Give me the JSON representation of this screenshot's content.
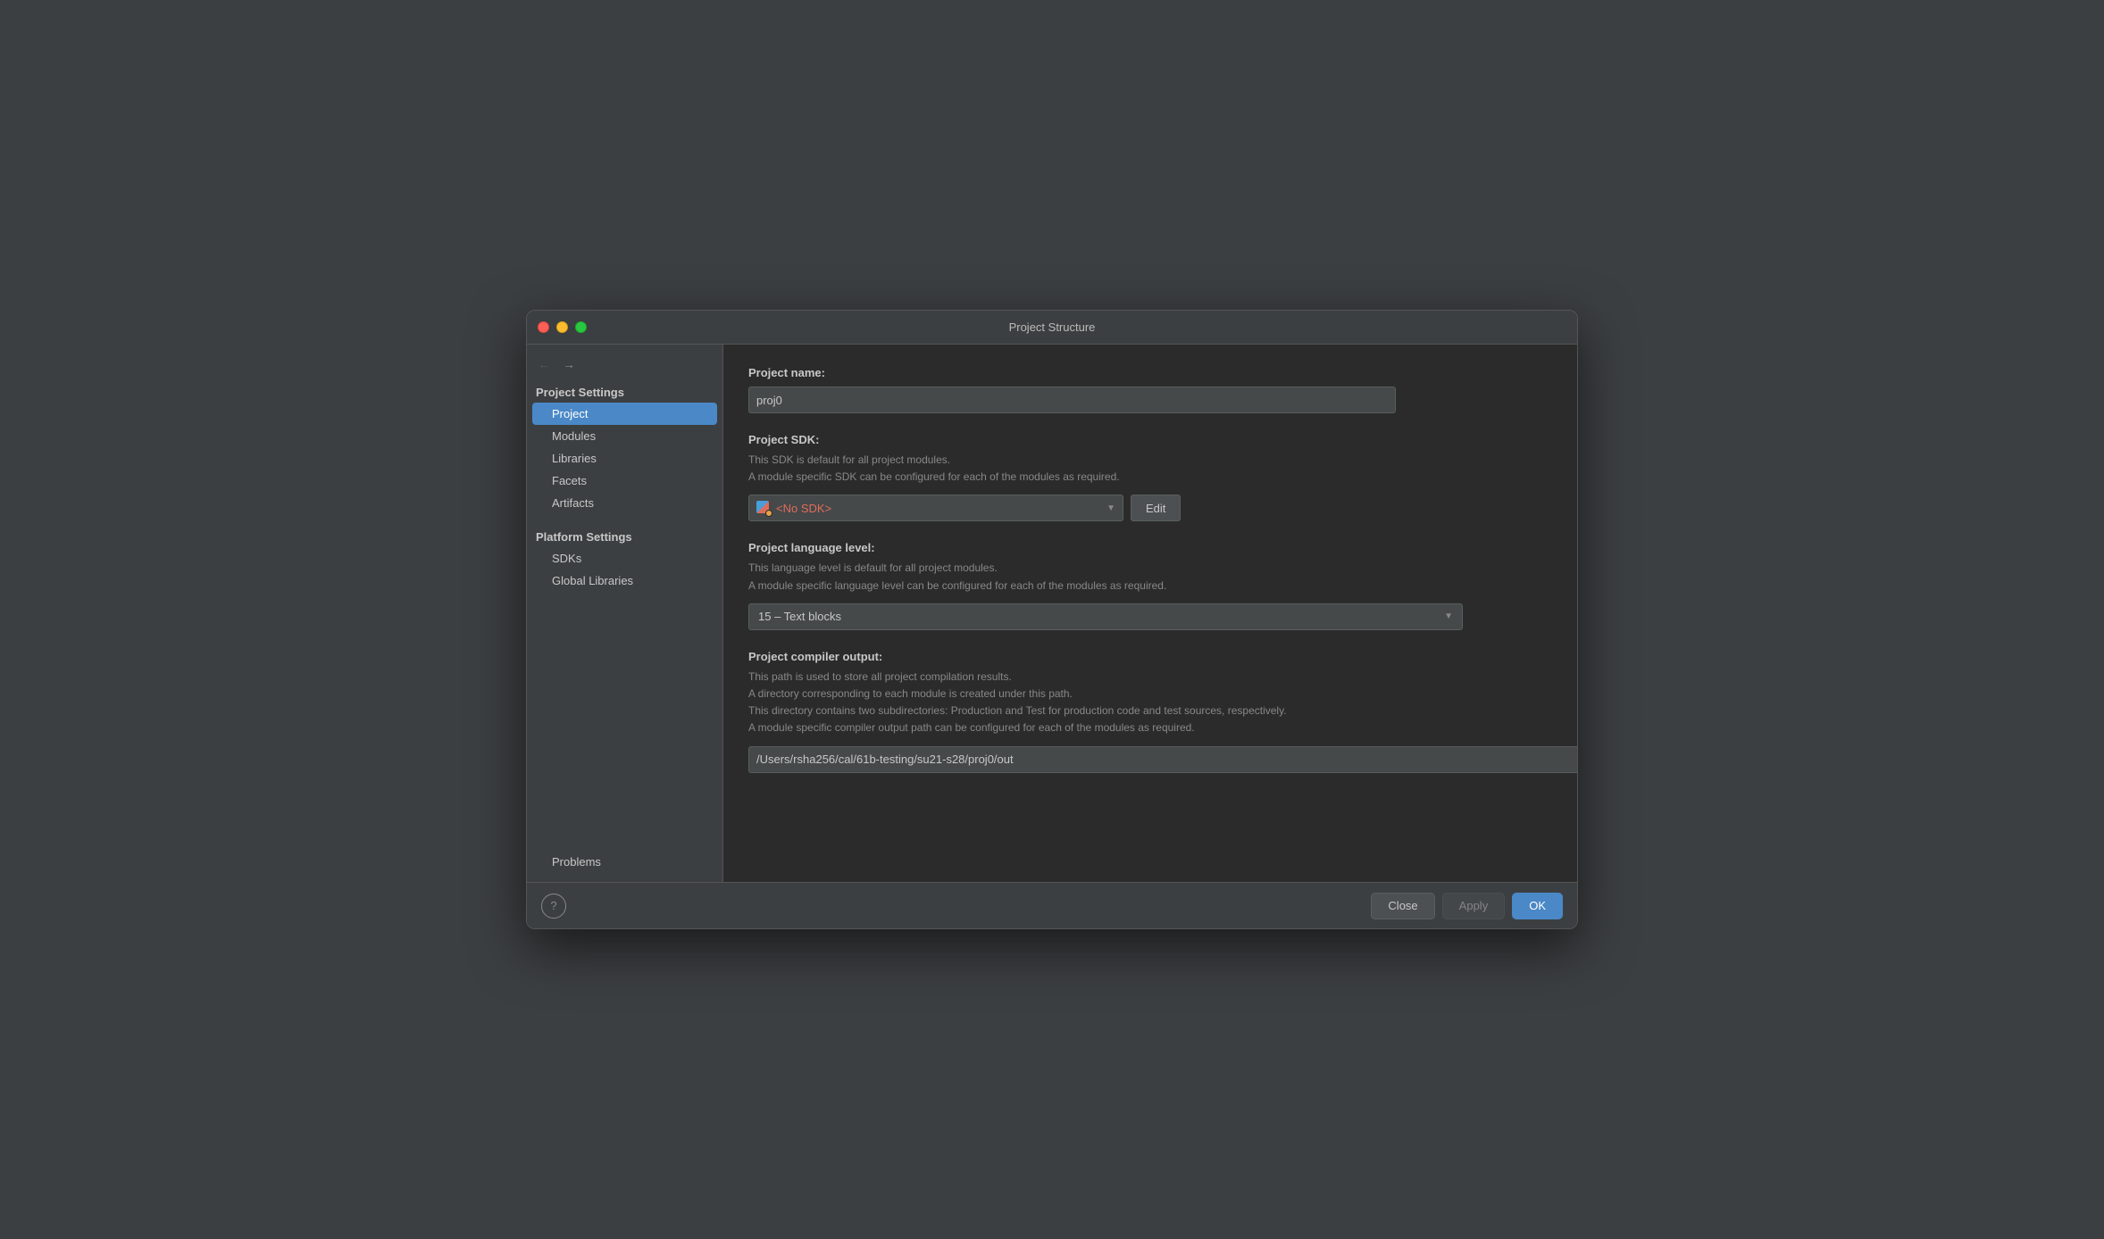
{
  "titlebar": {
    "title": "Project Structure"
  },
  "sidebar": {
    "nav": {
      "back_label": "←",
      "forward_label": "→"
    },
    "project_settings_header": "Project Settings",
    "items": [
      {
        "id": "project",
        "label": "Project",
        "active": true
      },
      {
        "id": "modules",
        "label": "Modules",
        "active": false
      },
      {
        "id": "libraries",
        "label": "Libraries",
        "active": false
      },
      {
        "id": "facets",
        "label": "Facets",
        "active": false
      },
      {
        "id": "artifacts",
        "label": "Artifacts",
        "active": false
      }
    ],
    "platform_settings_header": "Platform Settings",
    "platform_items": [
      {
        "id": "sdks",
        "label": "SDKs",
        "active": false
      },
      {
        "id": "global-libraries",
        "label": "Global Libraries",
        "active": false
      }
    ],
    "problems_label": "Problems"
  },
  "main": {
    "project_name": {
      "label": "Project name:",
      "value": "proj0"
    },
    "project_sdk": {
      "label": "Project SDK:",
      "desc1": "This SDK is default for all project modules.",
      "desc2": "A module specific SDK can be configured for each of the modules as required.",
      "sdk_value": "<No SDK>",
      "edit_label": "Edit"
    },
    "project_language_level": {
      "label": "Project language level:",
      "desc1": "This language level is default for all project modules.",
      "desc2": "A module specific language level can be configured for each of the modules as required.",
      "value": "15 – Text blocks"
    },
    "project_compiler_output": {
      "label": "Project compiler output:",
      "desc1": "This path is used to store all project compilation results.",
      "desc2": "A directory corresponding to each module is created under this path.",
      "desc3": "This directory contains two subdirectories: Production and Test for production code and test sources, respectively.",
      "desc4": "A module specific compiler output path can be configured for each of the modules as required.",
      "path": "/Users/rsha256/cal/61b-testing/su21-s28/proj0/out"
    }
  },
  "bottom": {
    "help_label": "?",
    "close_label": "Close",
    "apply_label": "Apply",
    "ok_label": "OK"
  }
}
